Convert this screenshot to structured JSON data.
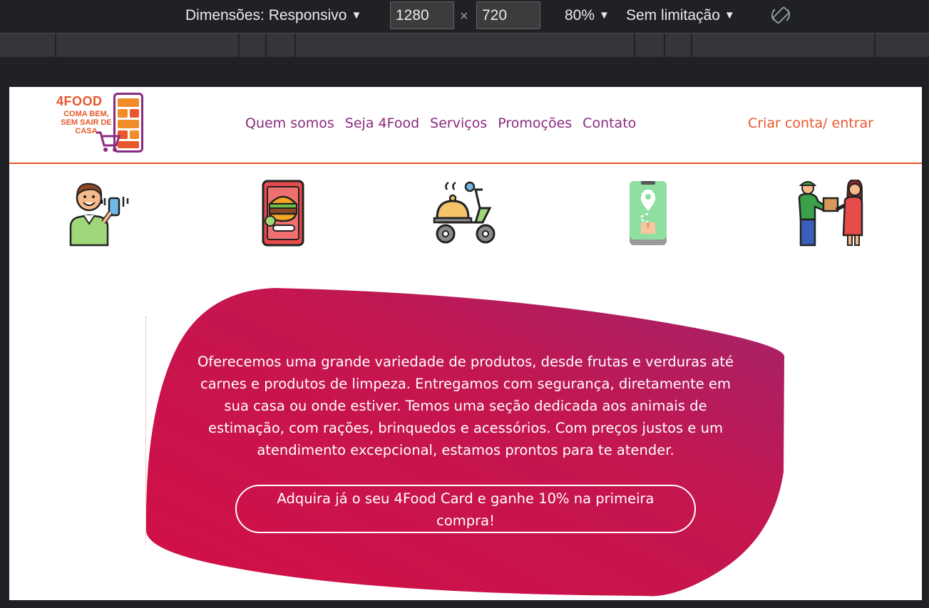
{
  "devtools": {
    "dimensions_label": "Dimensões: Responsivo",
    "width": "1280",
    "times": "×",
    "height": "720",
    "zoom": "80%",
    "throttle": "Sem limitação",
    "rotate_icon": "rotate-icon"
  },
  "header": {
    "logo": {
      "title": "4FOOD",
      "tagline": "COMA BEM, SEM SAIR DE CASA"
    },
    "nav": [
      "Quem somos",
      "Seja 4Food",
      "Serviços",
      "Promoções",
      "Contato"
    ],
    "login": "Criar conta/ entrar"
  },
  "steps": [
    {
      "icon": "man-with-phone-icon"
    },
    {
      "icon": "phone-food-app-icon"
    },
    {
      "icon": "delivery-scooter-icon"
    },
    {
      "icon": "map-tracking-icon"
    },
    {
      "icon": "delivery-handoff-icon"
    }
  ],
  "hero": {
    "description": "Oferecemos uma grande variedade de produtos, desde frutas e verduras até carnes e produtos de limpeza. Entregamos com segurança, diretamente em sua casa ou onde estiver. Temos uma seção dedicada aos animais de estimação, com rações, brinquedos e acessórios. Com preços justos e um atendimento excepcional, estamos prontos para te atender.",
    "cta": "Adquira já o seu 4Food Card e ganhe 10% na primeira compra!"
  },
  "colors": {
    "brand_purple": "#8a2a7e",
    "brand_orange": "#e8572c",
    "blob_start": "#d21047",
    "blob_end": "#a2246c"
  }
}
